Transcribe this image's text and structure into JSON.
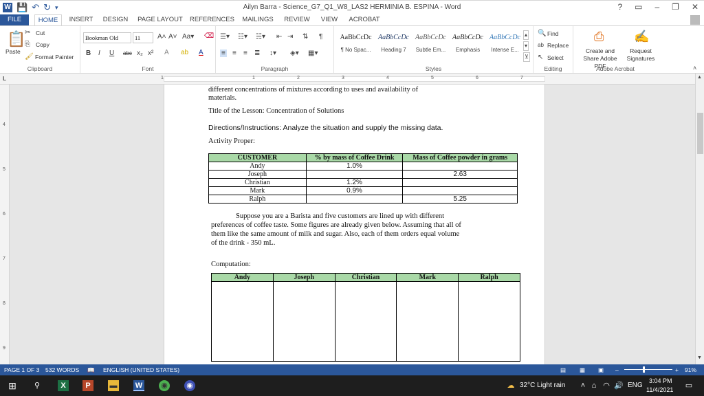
{
  "window": {
    "title": "Ailyn Barra - Science_G7_Q1_W8_LAS2 HERMINIA B. ESPINA - Word",
    "help": "?",
    "minimize": "–",
    "restore": "❐",
    "close": "✕"
  },
  "tabs": [
    "FILE",
    "HOME",
    "INSERT",
    "DESIGN",
    "PAGE LAYOUT",
    "REFERENCES",
    "MAILINGS",
    "REVIEW",
    "VIEW",
    "ACROBAT"
  ],
  "ribbon": {
    "clipboard": {
      "label": "Clipboard",
      "paste": "Paste",
      "cut": "Cut",
      "copy": "Copy",
      "format_painter": "Format Painter"
    },
    "font": {
      "label": "Font",
      "name": "Bookman Old",
      "size": "11"
    },
    "paragraph": {
      "label": "Paragraph"
    },
    "styles": {
      "label": "Styles",
      "items": [
        {
          "preview": "AaBbCcDc",
          "name": "¶ No Spac..."
        },
        {
          "preview": "AaBbCcDc",
          "name": "Heading 7"
        },
        {
          "preview": "AaBbCcDc",
          "name": "Subtle Em..."
        },
        {
          "preview": "AaBbCcDc",
          "name": "Emphasis"
        },
        {
          "preview": "AaBbCcDc",
          "name": "Intense E..."
        }
      ]
    },
    "editing": {
      "label": "Editing",
      "find": "Find",
      "replace": "Replace",
      "select": "Select"
    },
    "acrobat": {
      "label": "Adobe Acrobat",
      "create_share": "Create and Share Adobe PDF",
      "request_sig": "Request Signatures"
    }
  },
  "ruler_nums": [
    "1",
    "1",
    "2",
    "3",
    "4",
    "5",
    "6",
    "7"
  ],
  "vruler_nums": [
    "4",
    "5",
    "6",
    "7",
    "8",
    "9"
  ],
  "document": {
    "p1_line1": "different concentrations of mixtures according to uses and availability of",
    "p1_line2": "materials.",
    "lesson_title": "Title of the Lesson: Concentration of Solutions",
    "directions": "Directions/Instructions: Analyze the situation and supply the missing data.",
    "activity": "Activity Proper:",
    "table1": {
      "headers": [
        "CUSTOMER",
        "% by mass of Coffee Drink",
        "Mass of Coffee powder in grams"
      ],
      "rows": [
        [
          "Andy",
          "1.0%",
          ""
        ],
        [
          "Joseph",
          "",
          "2.63"
        ],
        [
          "Christian",
          "1.2%",
          ""
        ],
        [
          "Mark",
          "0.9%",
          ""
        ],
        [
          "Ralph",
          "",
          "5.25"
        ]
      ]
    },
    "para_lines": [
      "Suppose you are a Barista and five customers are lined up with different",
      "preferences of coffee taste. Some figures are already given below. Assuming that all of",
      "them like the same amount of milk and sugar. Also, each of them orders equal volume",
      "of the drink - 350 mL."
    ],
    "computation": "Computation:",
    "table2": {
      "headers": [
        "Andy",
        "Joseph",
        "Christian",
        "Mark",
        "Ralph"
      ]
    }
  },
  "status": {
    "page": "PAGE 1 OF 3",
    "words": "532 WORDS",
    "language": "ENGLISH (UNITED STATES)",
    "zoom": "91%"
  },
  "taskbar": {
    "weather": "32°C  Light rain",
    "lang": "ENG",
    "time": "3:04 PM",
    "date": "11/4/2021"
  }
}
